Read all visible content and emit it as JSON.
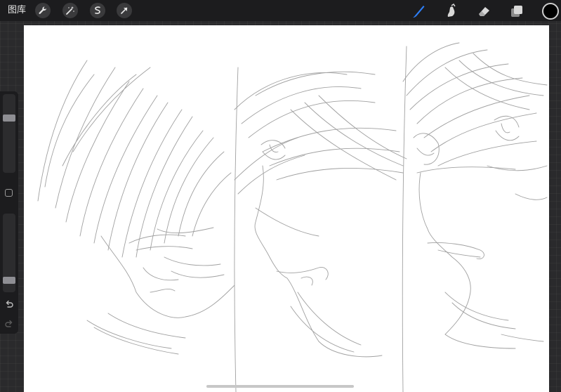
{
  "topbar": {
    "gallery_label": "图库",
    "tools_left": [
      {
        "name": "wrench-icon"
      },
      {
        "name": "magic-wand-icon"
      },
      {
        "name": "selection-icon"
      },
      {
        "name": "transform-arrow-icon"
      }
    ],
    "tools_right": [
      {
        "name": "brush-icon",
        "active": true
      },
      {
        "name": "smudge-icon"
      },
      {
        "name": "eraser-icon"
      },
      {
        "name": "layers-icon"
      }
    ],
    "current_color": "#000000",
    "accent_color": "#2d7ff9"
  },
  "sidebar": {
    "brush_size_level": 0.72,
    "opacity_level": 0.12,
    "icons": [
      "modifier-square-icon",
      "undo-icon",
      "redo-icon"
    ]
  },
  "canvas": {
    "background": "#ffffff",
    "stroke_color": "#9a9a9a"
  }
}
